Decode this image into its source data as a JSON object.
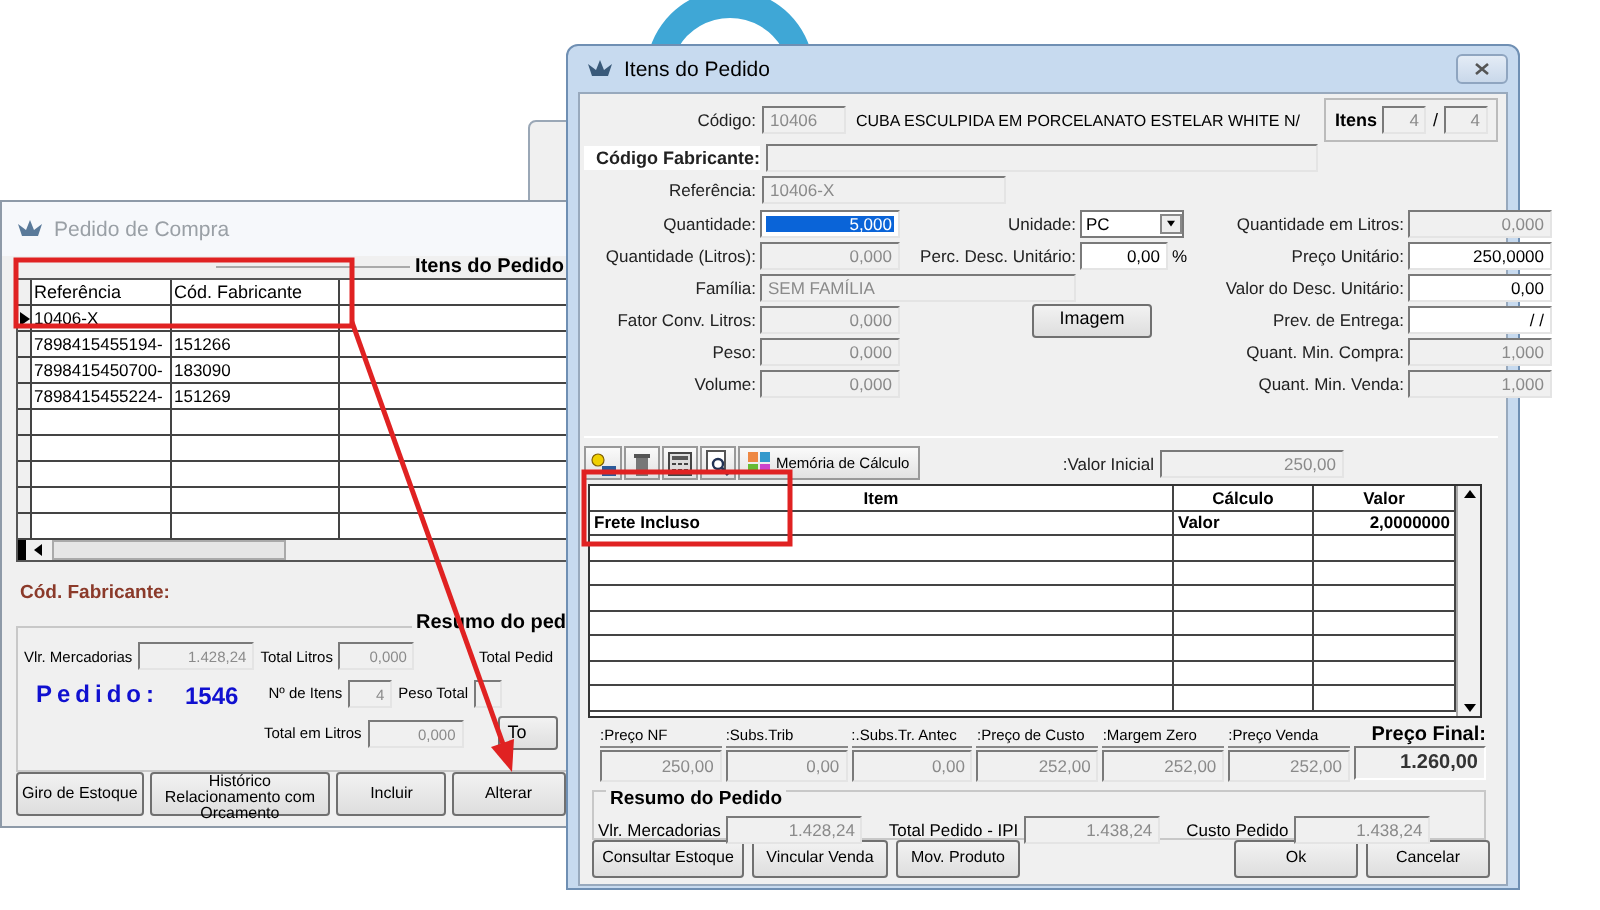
{
  "order_window": {
    "title": "Pedido de Compra",
    "group_title": "Itens do Pedido",
    "columns": [
      "Referência",
      "Cód. Fabricante"
    ],
    "rows": [
      {
        "reference": "10406-X",
        "selected": true
      },
      {
        "reference": "7898415455194-",
        "manufacturer_code": "151266",
        "selected": false
      },
      {
        "reference": "7898415450700-",
        "manufacturer_code": "183090",
        "selected": false
      },
      {
        "reference": "7898415455224-",
        "manufacturer_code": "151269",
        "selected": false
      }
    ],
    "manufacturer_label": "Cód. Fabricante:",
    "summary_title": "Resumo do ped",
    "merchandise": {
      "label": "Vlr. Mercadorias",
      "value": "1.428,24"
    },
    "total_liters": {
      "label": "Total Litros",
      "value": "0,000"
    },
    "total_order_label": "Total Pedid",
    "order_label": "Pedido:",
    "order_number": "1546",
    "item_count": {
      "label": "Nº de Itens",
      "value": "4"
    },
    "weight_label": "Peso Total",
    "total_in_liters": {
      "label": "Total em Litros",
      "value": "0,000"
    },
    "side_button": "To",
    "buttons": [
      "Giro de Estoque",
      "Histórico Relacionamento com Orcamento",
      "Incluir",
      "Alterar"
    ]
  },
  "items_window": {
    "title": "Itens do Pedido",
    "counter": {
      "label": "Itens",
      "current": "4",
      "separator": "/",
      "total": "4"
    },
    "code": {
      "label": "Código:",
      "value": "10406",
      "description": "CUBA ESCULPIDA EM PORCELANATO ESTELAR WHITE N/"
    },
    "manufacturer_code": {
      "label": "Código Fabricante:"
    },
    "reference": {
      "label": "Referência:",
      "value": "10406-X"
    },
    "left_fields": [
      {
        "label": "Quantidade:",
        "value": "5,000",
        "focused": true,
        "kind": "number"
      },
      {
        "label": "Quantidade (Litros):",
        "value": "0,000",
        "focused": false,
        "kind": "number"
      },
      {
        "label": "Família:",
        "value": "SEM FAMÍLIA",
        "focused": false,
        "kind": "text"
      },
      {
        "label": "Fator Conv. Litros:",
        "value": "0,000",
        "focused": false,
        "kind": "number"
      },
      {
        "label": "Peso:",
        "value": "0,000",
        "focused": false,
        "kind": "number"
      },
      {
        "label": "Volume:",
        "value": "0,000",
        "focused": false,
        "kind": "number"
      }
    ],
    "unit": {
      "label": "Unidade:",
      "value": "PC"
    },
    "discount_percent": {
      "label": "Perc. Desc. Unitário:",
      "value": "0,00",
      "suffix": "%"
    },
    "image_button": "Imagem",
    "right_fields": [
      {
        "label": "Quantidade em Litros:",
        "value": "0,000",
        "editable": false
      },
      {
        "label": "Preço Unitário:",
        "value": "250,0000",
        "editable": true
      },
      {
        "label": "Valor do Desc. Unitário:",
        "value": "0,00",
        "editable": true
      },
      {
        "label": "Prev. de Entrega:",
        "value": " / /",
        "editable": true
      },
      {
        "label": "Quant. Min. Compra:",
        "value": "1,000",
        "editable": false
      },
      {
        "label": "Quant. Min. Venda:",
        "value": "1,000",
        "editable": false
      }
    ],
    "calc_memory_button": "Memória de Cálculo",
    "initial_value": {
      "label": ":Valor Inicial",
      "value": "250,00"
    },
    "columns": [
      "Item",
      "Cálculo",
      "Valor"
    ],
    "rows": [
      {
        "item": "Frete Incluso",
        "calculation": "Valor",
        "value": "2,0000000"
      }
    ],
    "prices": [
      {
        "label": ":Preço NF",
        "value": "250,00"
      },
      {
        "label": ":Subs.Trib",
        "value": "0,00"
      },
      {
        "label": ":.Subs.Tr. Antec",
        "value": "0,00"
      },
      {
        "label": ":Preço de Custo",
        "value": "252,00"
      },
      {
        "label": ":Margem Zero",
        "value": "252,00"
      },
      {
        "label": ":Preço Venda",
        "value": "252,00"
      }
    ],
    "final_price": {
      "label": "Preço Final:",
      "value": "1.260,00"
    },
    "summary": {
      "title": "Resumo do Pedido",
      "fields": [
        {
          "label": "Vlr. Mercadorias",
          "value": "1.428,24"
        },
        {
          "label": "Total Pedido - IPI",
          "value": "1.438,24"
        },
        {
          "label": "Custo Pedido",
          "value": "1.438,24"
        }
      ]
    },
    "left_buttons": [
      "Consultar Estoque",
      "Vincular Venda",
      "Mov. Produto"
    ],
    "right_buttons": [
      "Ok",
      "Cancelar"
    ]
  }
}
